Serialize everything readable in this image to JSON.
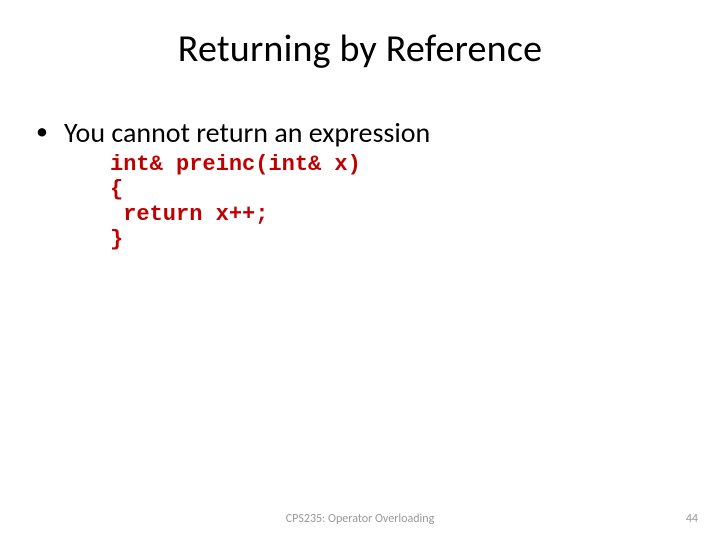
{
  "title": "Returning by Reference",
  "bullet": {
    "mark": "•",
    "text": "You cannot return an expression"
  },
  "code": {
    "line1": "int& preinc(int& x)",
    "line2": "{",
    "line3": " return x++;",
    "line4": "}"
  },
  "footer": {
    "center": "CPS235: Operator Overloading",
    "pageNumber": "44"
  }
}
